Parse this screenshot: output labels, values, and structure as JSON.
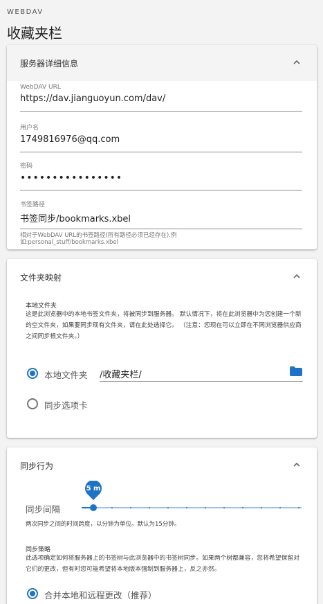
{
  "header": {
    "eyebrow": "WEBDAV",
    "title": "收藏夹栏"
  },
  "server_card": {
    "title": "服务器详细信息",
    "url_label": "WebDAV URL",
    "url_value": "https://dav.jianguoyun.com/dav/",
    "user_label": "用户名",
    "user_value": "1749816976@qq.com",
    "password_label": "密码",
    "password_value": "••••••••••••••••",
    "path_label": "书签路径",
    "path_value": "书签同步/bookmarks.xbel",
    "path_hint_1": "相对于WebDAV URL的书签路径(所有路径必须已经存在).例",
    "path_hint_2": "如:personal_stuff/bookmarks.xbel"
  },
  "mapping_card": {
    "title": "文件夹映射",
    "local_folder_heading": "本地文件夹",
    "description": "这是此浏览器中的本地书签文件夹，将被同步到服务器。 默认情况下，将在此浏览器中为您创建一个新的空文件夹，如果要同步现有文件夹，请在此处选择它。 （注意：您现在可以立即在不同浏览器供应商之间同步根文件夹。）",
    "option_local_label": "本地文件夹",
    "option_local_value": "/收藏夹栏/",
    "option_tabs_label": "同步选项卡",
    "selected": "local"
  },
  "sync_card": {
    "title": "同步行为",
    "interval_label": "同步间隔",
    "interval_value": "5 m",
    "interval_minutes": 5,
    "interval_hint": "两次同步之间的时间跨度，以分钟为单位。默认为15分钟。",
    "strategy_heading": "同步策略",
    "strategy_description": "此选项确定如何将服务器上的书签树与此浏览器中的书签树同步。如果两个树都兼容，您将希望保留对它们的更改，但有时您可能希望将本地版本强制到服务器上，反之亦然。",
    "strategy_option_merge": "合并本地和远程更改（推荐）"
  },
  "colors": {
    "accent": "#1f73c6",
    "background": "#f3f3f3"
  }
}
